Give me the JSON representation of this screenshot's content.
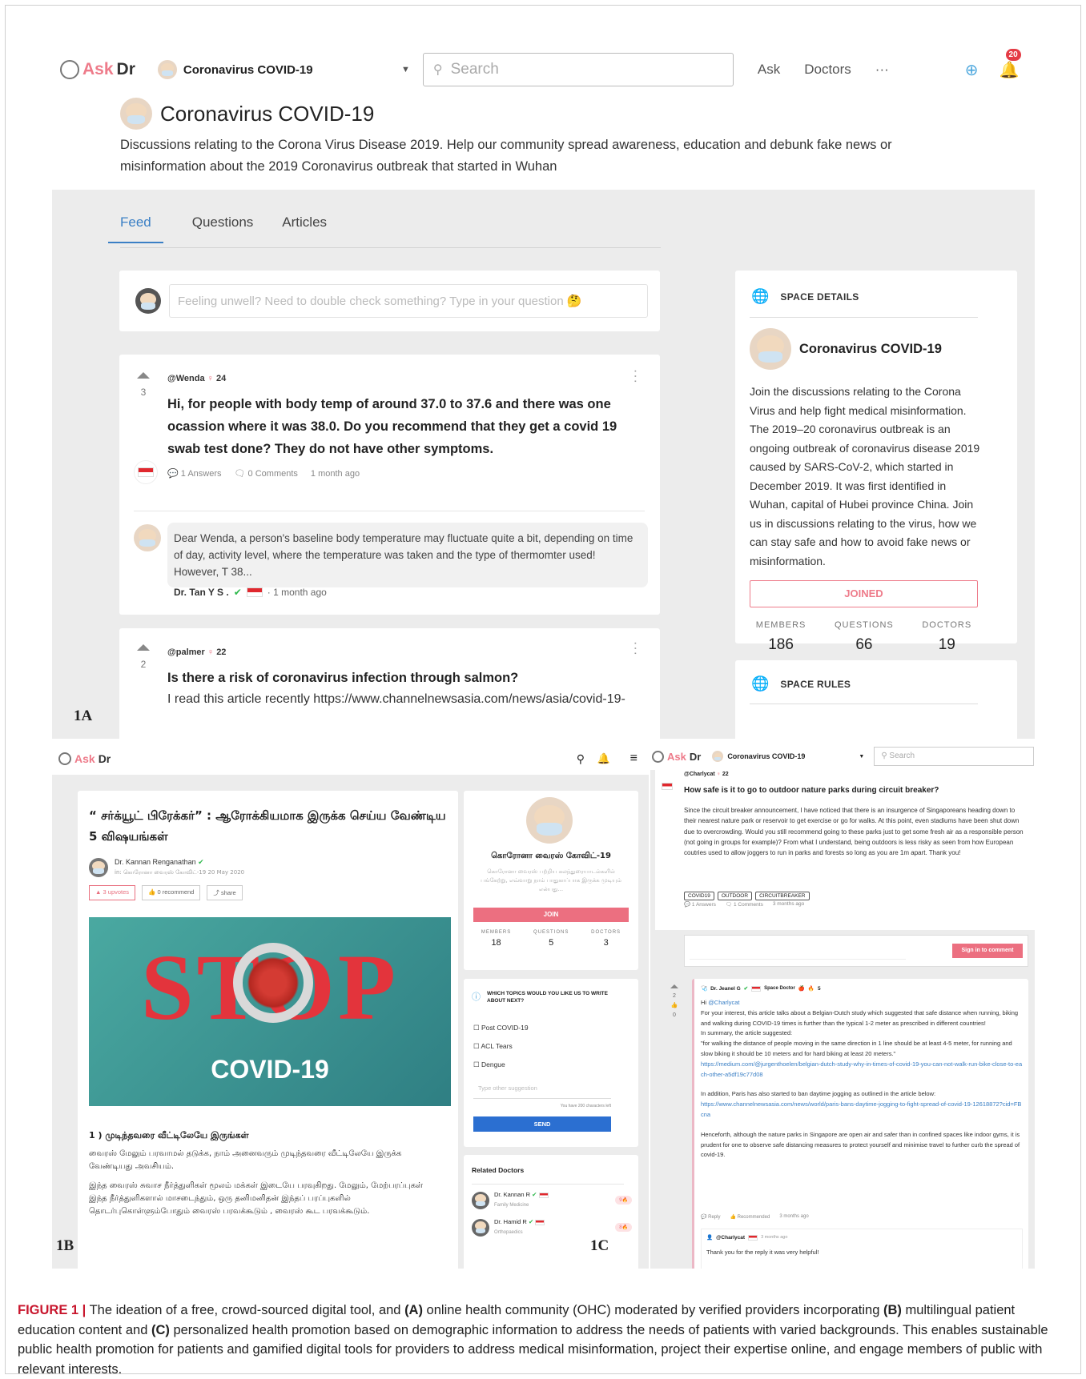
{
  "panels": {
    "a": "1A",
    "b": "1B",
    "c": "1C"
  },
  "a": {
    "logo_ask": "Ask",
    "logo_dr": "Dr",
    "space_dropdown": "Coronavirus COVID-19",
    "search_placeholder": "Search",
    "nav": [
      "Ask",
      "Doctors",
      "···"
    ],
    "notif_count": "20",
    "title": "Coronavirus COVID-19",
    "description": "Discussions relating to the Corona Virus Disease 2019. Help our community spread awareness, education and debunk fake news or misinformation about the 2019 Coronavirus outbreak that started in Wuhan",
    "tabs": [
      "Feed",
      "Questions",
      "Articles"
    ],
    "ask_placeholder": "Feeling unwell? Need to double check something? Type in your question 🤔",
    "post1": {
      "user": "@Wenda",
      "user_count": "24",
      "votes": "3",
      "title": "Hi, for people with body temp of around 37.0 to 37.6 and there was one ocassion where it was 38.0. Do you recommend that they get a covid 19 swab test done? They do not have other symptoms.",
      "answers": "1 Answers",
      "comments": "0 Comments",
      "time": "1 month ago",
      "answer_text": "Dear Wenda, a person's baseline body temperature may fluctuate quite a bit, depending on time of day, activity level, where the temperature was taken and the type of thermomter used! However, T 38...",
      "answer_author": "Dr. Tan Y S .",
      "answer_time": "· 1 month ago"
    },
    "post2": {
      "user": "@palmer",
      "user_count": "22",
      "votes": "2",
      "title": "Is there a risk of coronavirus infection through salmon?",
      "body": "I read this article recently https://www.channelnewsasia.com/news/asia/covid-19-"
    },
    "space_details": {
      "heading": "SPACE DETAILS",
      "name": "Coronavirus COVID-19",
      "text": "Join the discussions relating to the Corona Virus and help fight medical misinformation. The 2019–20 coronavirus outbreak is an ongoing outbreak of coronavirus disease 2019 caused by SARS-CoV-2, which started in December 2019. It was first identified in Wuhan, capital of Hubei province China. Join us in discussions relating to the virus, how we can stay safe and how to avoid fake news or misinformation.",
      "joined": "JOINED",
      "stats": [
        {
          "label": "MEMBERS",
          "value": "186"
        },
        {
          "label": "QUESTIONS",
          "value": "66"
        },
        {
          "label": "DOCTORS",
          "value": "19"
        }
      ]
    },
    "space_rules": "SPACE RULES"
  },
  "b": {
    "title": "“ சர்க்யூட் பிரேக்கர்” : ஆரோக்கியமாக இருக்க செய்ய வேண்டிய 5 விஷயங்கள்",
    "author": "Dr. Kannan Renganathan",
    "author_in": "in: கொரோனா வைரஸ் கோவிட்-19",
    "author_date": "20 May 2020",
    "upvotes": "3 upvotes",
    "recommend": "0 recommend",
    "share": "share",
    "image_stop": "STOP",
    "image_covid": "COVID-19",
    "section_heading": "1 ) முடிந்தவரை வீட்டிலேயே இருங்கள்",
    "para1": "வைரஸ் மேலும் பரவாமல் தடுக்க, நாம் அனைவரும் முடிந்தவரை வீட்டிலேயே இருக்க வேண்டியது அவசியம்.",
    "para2": "இந்த வைரஸ் சுவாச நீர்த்துளிகள் மூலம் மக்கள் இடையே பரவுகிறது. மேலும், மேற்பரப்புகள் இந்த நீர்த்துளிகளால் மாசடைந்தும், ஒரு தனிமனிதன் இந்தப் பரப்புகளில் தொடர்புகொள்ளும்போதும் வைரஸ் பரவக்கூடும் , வைரஸ் கூட பரவக்கூடும்.",
    "space_name": "கொரோனா வைரஸ் கோவிட்-19",
    "space_desc": "கொரோனா வைரஸ் பற்றிய கலந்துரையாடல்களில் பங்கேற்று, எவ்வாறு நாம் பாதுகாப்பாக இருக்க முடியும் என்பது...",
    "join": "JOIN",
    "stats": [
      {
        "label": "MEMBERS",
        "value": "18"
      },
      {
        "label": "QUESTIONS",
        "value": "5"
      },
      {
        "label": "DOCTORS",
        "value": "3"
      }
    ],
    "topics_q": "WHICH TOPICS WOULD YOU LIKE US TO WRITE ABOUT NEXT?",
    "topics": [
      "Post COVID-19",
      "ACL Tears",
      "Dengue"
    ],
    "suggest_placeholder": "Type other suggestion",
    "chars_left": "You have 200 characters left",
    "send": "SEND",
    "related": "Related Doctors",
    "doctors": [
      {
        "name": "Dr. Kannan R",
        "spec": "Family Medicine",
        "score": "9🔥"
      },
      {
        "name": "Dr. Hamid R",
        "spec": "Orthopaedics",
        "score": "8🔥"
      }
    ]
  },
  "c": {
    "space_dropdown": "Coronavirus COVID-19",
    "search_placeholder": "Search",
    "user": "@Charlycat",
    "user_count": "22",
    "title": "How safe is it to go to outdoor nature parks during circuit breaker?",
    "body": "Since the circuit breaker announcement, I have noticed that there is an insurgence of Singaporeans heading down to their nearest nature park or reservoir to get exercise or go for walks. At this point, even stadiums have been shut down due to overcrowding. Would you still recommend going to these parks just to get some fresh air as a responsible person (not going in groups for example)? From what I understand, being outdoors is less risky as seen from how European coutries used to allow joggers to run in parks and forests so long as you are 1m apart. Thank you!",
    "tags": [
      "COVID19",
      "OUTDOOR",
      "CIRCUITBREAKER"
    ],
    "answers": "1 Answers",
    "comments": "1 Comments",
    "time": "3 months ago",
    "sign_in": "Sign in to comment",
    "votes": "2",
    "votes2": "0",
    "ans_author": "Dr. Jeanel G",
    "ans_role": "Space Doctor",
    "ans_score": "5",
    "ans_hi": "Hi",
    "ans_mention": "@Charlycat",
    "ans_p1": "For your interest, this article talks about a Belgian-Dutch study which suggested that safe distance when running, biking and walking during COVID-19 times is further than the typical 1-2 meter as prescribed in different countries!",
    "ans_p2": "In summary, the article suggested:",
    "ans_p3": "\"for walking the distance of people moving in the same direction in 1 line should be at least 4-5 meter, for running and slow biking it should be 10 meters and for hard biking at least 20 meters.\"",
    "ans_link1": "https://medium.com/@jurgenthoelen/belgian-dutch-study-why-in-times-of-covid-19-you-can-not-walk-run-bike-close-to-each-other-a5df19c77d08",
    "ans_p4": "In addition, Paris has also started to ban daytime jogging as outlined in the article below:",
    "ans_link2": "https://www.channelnewsasia.com/news/world/paris-bans-daytime-jogging-to-fight-spread-of-covid-19-12618872?cid=FBcna",
    "ans_p5": "Henceforth, although the nature parks in Singapore are open air and safer than in confined spaces like indoor gyms, it is prudent for one to observe safe distancing measures to protect yourself and minimise travel to further curb the spread of covid-19.",
    "reply": "Reply",
    "recommended": "Recommended",
    "ans_time": "3 months ago",
    "reply_user": "@Charlycat",
    "reply_time": "3 months ago",
    "reply_text": "Thank you for the reply it was very helpful!"
  },
  "caption": {
    "label": "FIGURE 1 |",
    "t1": " The ideation of a free, crowd-sourced digital tool, and ",
    "b1": "(A)",
    "t2": " online health community (OHC) moderated by verified providers incorporating ",
    "b2": "(B)",
    "t3": " multilingual patient education content and ",
    "b3": "(C)",
    "t4": " personalized health promotion based on demographic information to address the needs of patients with varied backgrounds. This enables sustainable public health promotion for patients and gamified digital tools for providers to address medical misinformation, project their expertise online, and engage members of public with relevant interests."
  }
}
